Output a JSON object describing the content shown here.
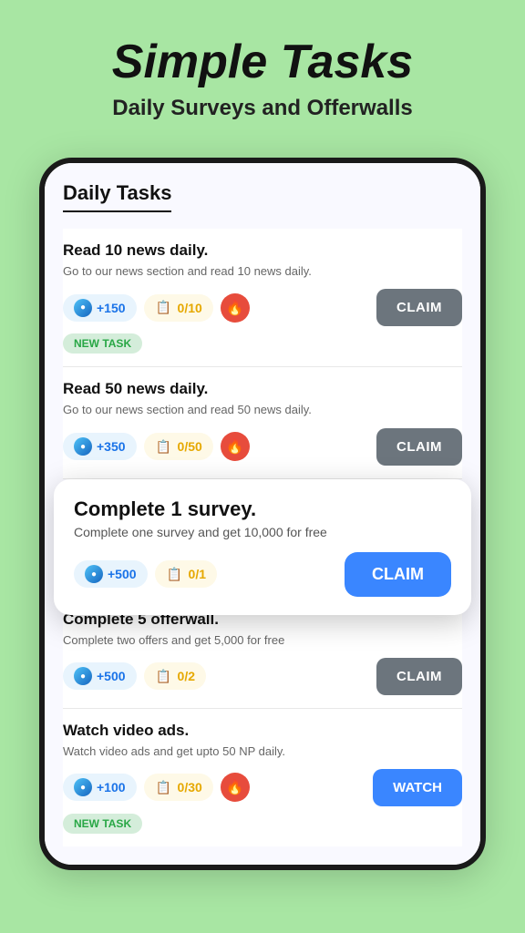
{
  "header": {
    "title": "Simple Tasks",
    "subtitle": "Daily Surveys and Offerwalls"
  },
  "phone": {
    "section_title": "Daily Tasks",
    "tasks": [
      {
        "id": "task-read-10",
        "title": "Read 10 news daily.",
        "desc": "Go to our news section and read 10 news daily.",
        "coin_label": "+150",
        "progress_label": "0/10",
        "has_fire": true,
        "has_new_task": true,
        "claim_label": "CLAIM"
      },
      {
        "id": "task-read-50",
        "title": "Read 50 news daily.",
        "desc": "Go to our news section and read 50 news daily.",
        "coin_label": "+350",
        "progress_label": "0/50",
        "has_fire": true,
        "has_new_task": false,
        "claim_label": "CLAIM"
      }
    ],
    "highlight_task": {
      "title": "Complete 1 survey.",
      "desc": "Complete one survey and get 10,000 for free",
      "coin_label": "+500",
      "progress_label": "0/1",
      "claim_label": "CLAIM"
    },
    "bottom_tasks": [
      {
        "id": "task-offerwall",
        "title": "Complete 5 offerwall.",
        "desc": "Complete two offers and get 5,000 for free",
        "coin_label": "+500",
        "progress_label": "0/2",
        "has_fire": false,
        "has_new_task": false,
        "claim_label": "CLAIM"
      },
      {
        "id": "task-video",
        "title": "Watch video ads.",
        "desc": "Watch video ads and get upto 50 NP daily.",
        "coin_label": "+100",
        "progress_label": "0/30",
        "has_fire": true,
        "has_new_task": true,
        "watch_label": "WATCH"
      }
    ]
  }
}
